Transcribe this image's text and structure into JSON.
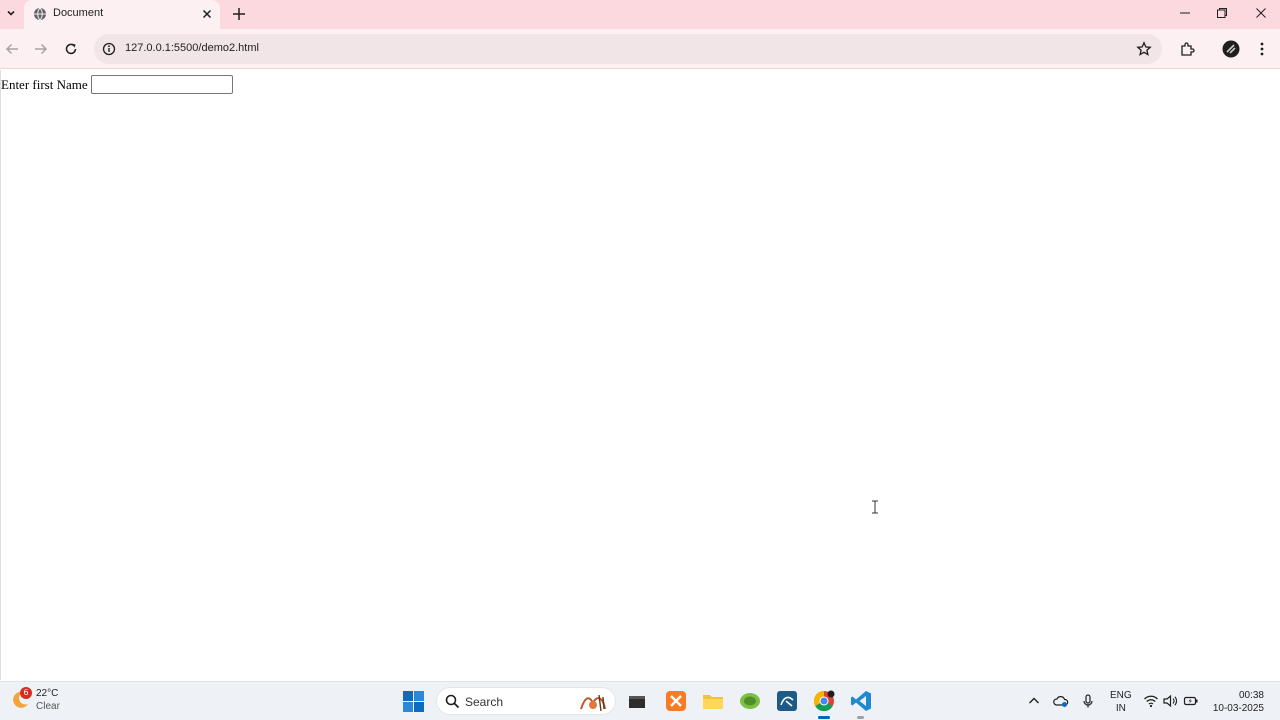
{
  "browser": {
    "tab": {
      "title": "Document",
      "favicon": "globe-icon"
    },
    "url": "127.0.0.1:5500/demo2.html",
    "colors": {
      "frame": "#fbd9df",
      "toolbar": "#fdf0f2",
      "omnibox": "#f2e5e8"
    }
  },
  "page": {
    "form": {
      "label": "Enter first Name ",
      "input_value": ""
    }
  },
  "taskbar": {
    "weather": {
      "badge": "6",
      "temp": "22°C",
      "condition": "Clear"
    },
    "search": {
      "placeholder": "Search"
    },
    "apps": [
      "files-icon",
      "xampp-icon",
      "file-explorer-icon",
      "notepad-plus-icon",
      "mysql-workbench-icon",
      "chrome-icon",
      "vscode-icon"
    ],
    "language": {
      "line1": "ENG",
      "line2": "IN"
    },
    "clock": {
      "time": "00:38",
      "date": "10-03-2025"
    }
  }
}
